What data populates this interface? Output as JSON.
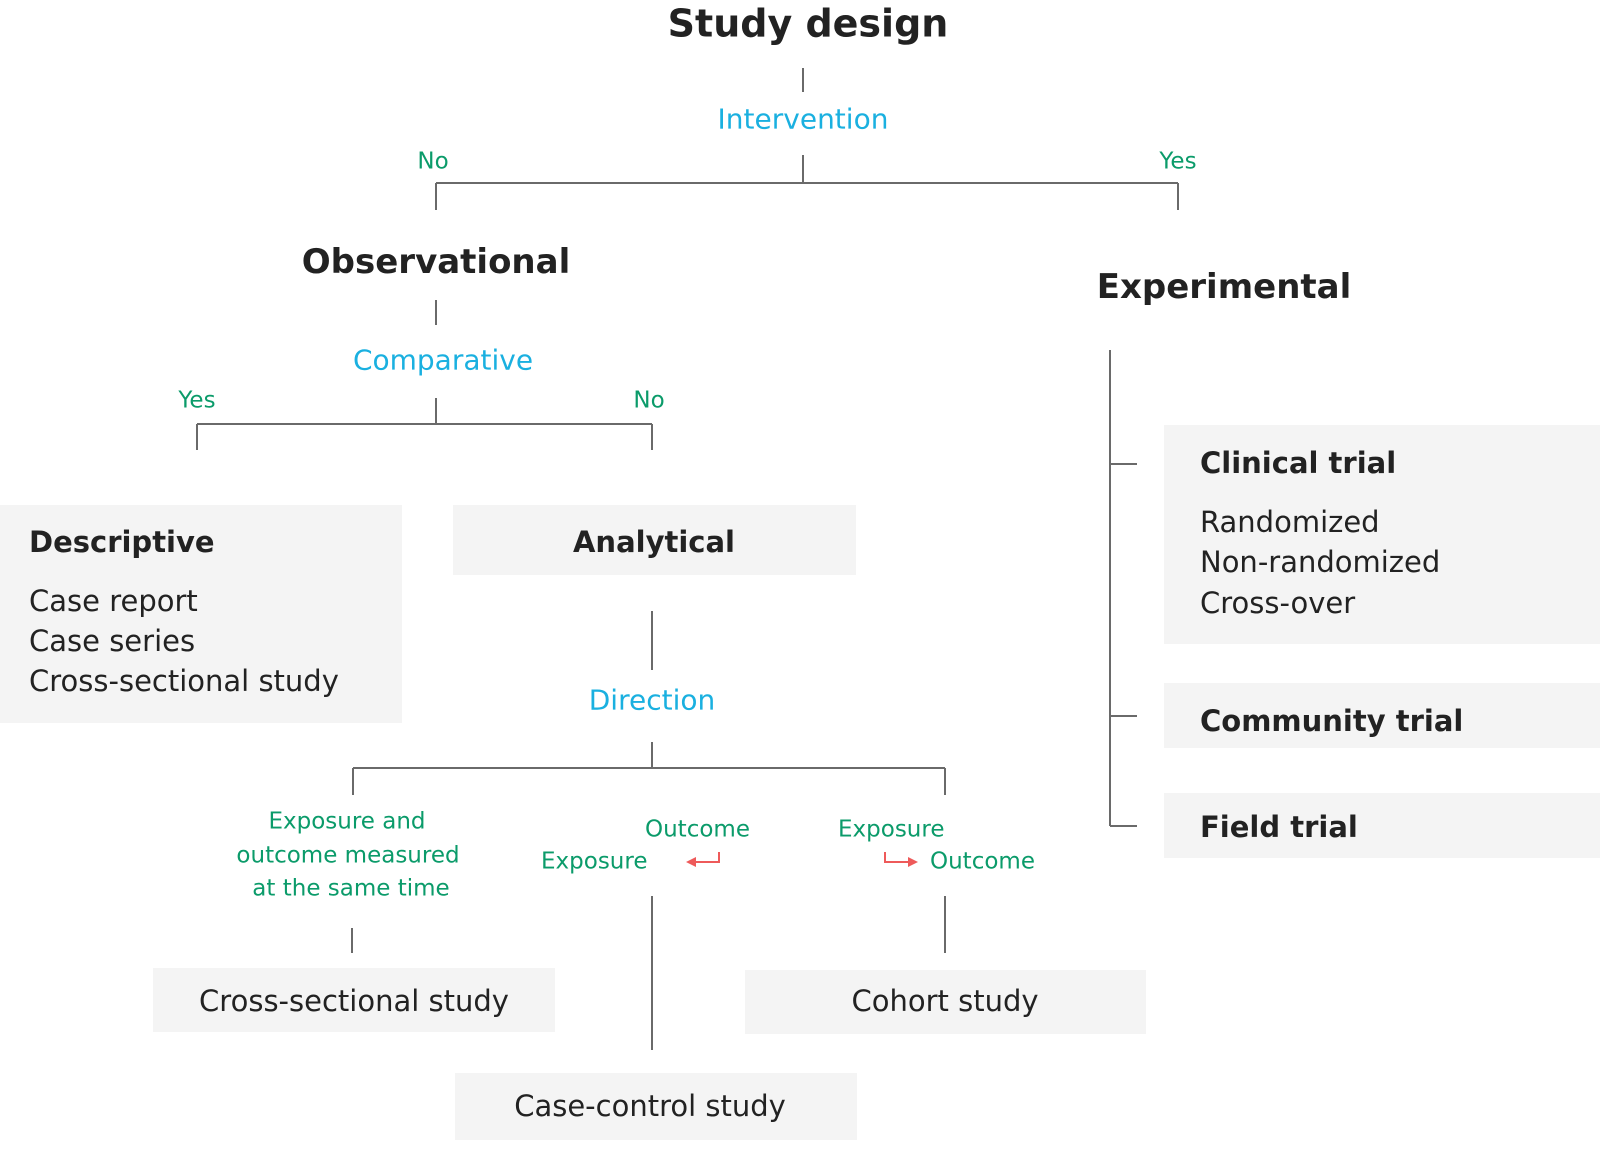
{
  "title": "Study design",
  "intervention": {
    "label": "Intervention",
    "no": "No",
    "yes": "Yes"
  },
  "observational": {
    "label": "Observational",
    "question": "Comparative",
    "yes": "Yes",
    "no": "No"
  },
  "experimental": {
    "label": "Experimental"
  },
  "descriptive": {
    "heading": "Descriptive",
    "items": [
      "Case report",
      "Case series",
      "Cross-sectional study"
    ]
  },
  "analytical": {
    "heading": "Analytical",
    "question": "Direction",
    "same_time": [
      "Exposure and",
      "outcome measured",
      "at the same time"
    ],
    "retro": {
      "outcome": "Outcome",
      "exposure": "Exposure"
    },
    "prosp": {
      "exposure": "Exposure",
      "outcome": "Outcome"
    },
    "cross_sectional": "Cross-sectional study",
    "case_control": "Case-control study",
    "cohort": "Cohort study"
  },
  "trials": {
    "clinical": {
      "heading": "Clinical trial",
      "items": [
        "Randomized",
        "Non-randomized",
        "Cross-over"
      ]
    },
    "community": "Community trial",
    "field": "Field trial"
  },
  "colors": {
    "question": "#1ab0e0",
    "answer": "#0b9b6a",
    "arrow": "#ee5a5a",
    "box": "#f4f4f4",
    "line": "#6a6a6a"
  }
}
